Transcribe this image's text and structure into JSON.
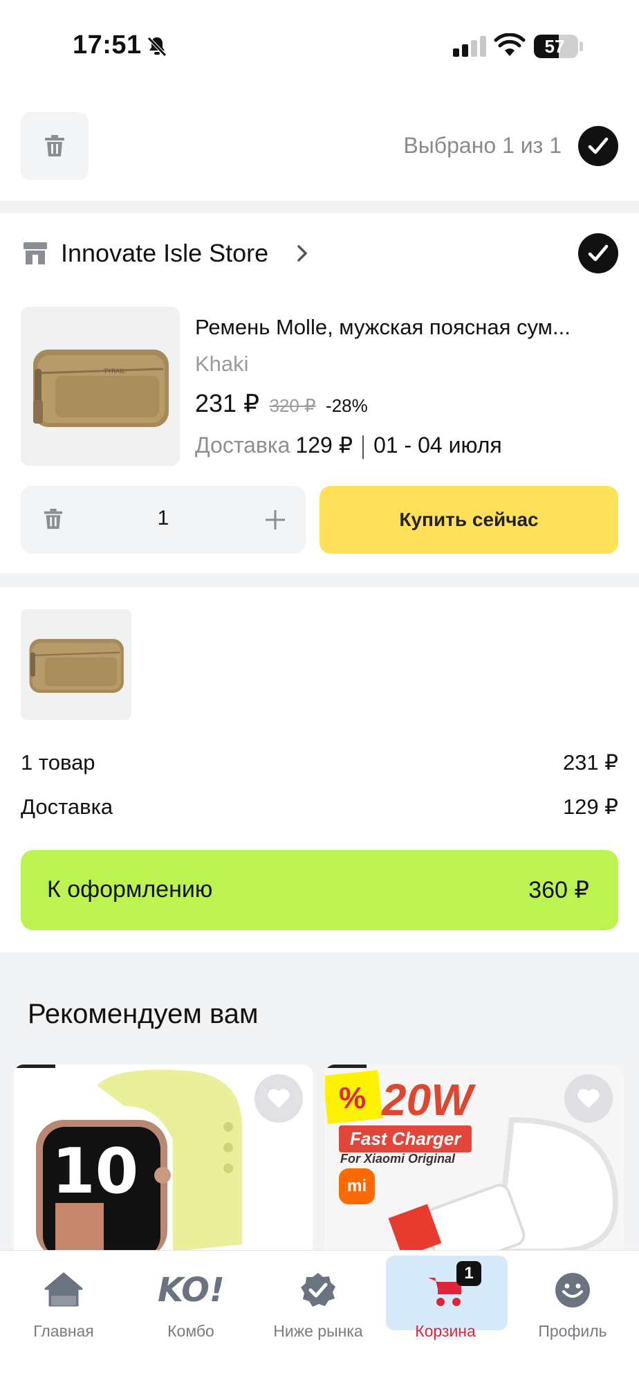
{
  "status_bar": {
    "time": "17:51",
    "battery": "57"
  },
  "top_bar": {
    "selected_text": "Выбрано 1 из 1"
  },
  "store": {
    "name": "Innovate Isle Store",
    "item": {
      "title": "Ремень Molle, мужская поясная сум...",
      "variant": "Khaki",
      "price": "231 ₽",
      "old_price": "320 ₽",
      "discount": "-28%",
      "delivery_label": "Доставка",
      "delivery_price": "129 ₽",
      "delivery_dates": "01 - 04 июля",
      "quantity": "1",
      "buy_label": "Купить сейчас"
    }
  },
  "summary": {
    "items_label": "1 товар",
    "items_value": "231 ₽",
    "delivery_label": "Доставка",
    "delivery_value": "129 ₽",
    "checkout_label": "К оформлению",
    "checkout_total": "360 ₽"
  },
  "recommend": {
    "title": "Рекомендуем вам",
    "cards": [
      {
        "image": "watch-image"
      },
      {
        "image": "charger-image",
        "badge": "%",
        "headline": "20W",
        "tag": "Fast Charger",
        "subtitle": "For Xiaomi Original",
        "logo": "mi"
      }
    ]
  },
  "tabs": [
    {
      "label": "Главная",
      "icon": "home-icon"
    },
    {
      "label": "Комбо",
      "icon": "ko-icon"
    },
    {
      "label": "Ниже рынка",
      "icon": "badge-check-icon"
    },
    {
      "label": "Корзина",
      "icon": "cart-icon",
      "badge": "1",
      "active": true
    },
    {
      "label": "Профиль",
      "icon": "profile-icon"
    }
  ],
  "colors": {
    "accent_yellow": "#ffe05a",
    "checkout_green": "#bdf351",
    "active_tab_bg": "#d7eafc",
    "active_tab_text": "#e0243a"
  }
}
